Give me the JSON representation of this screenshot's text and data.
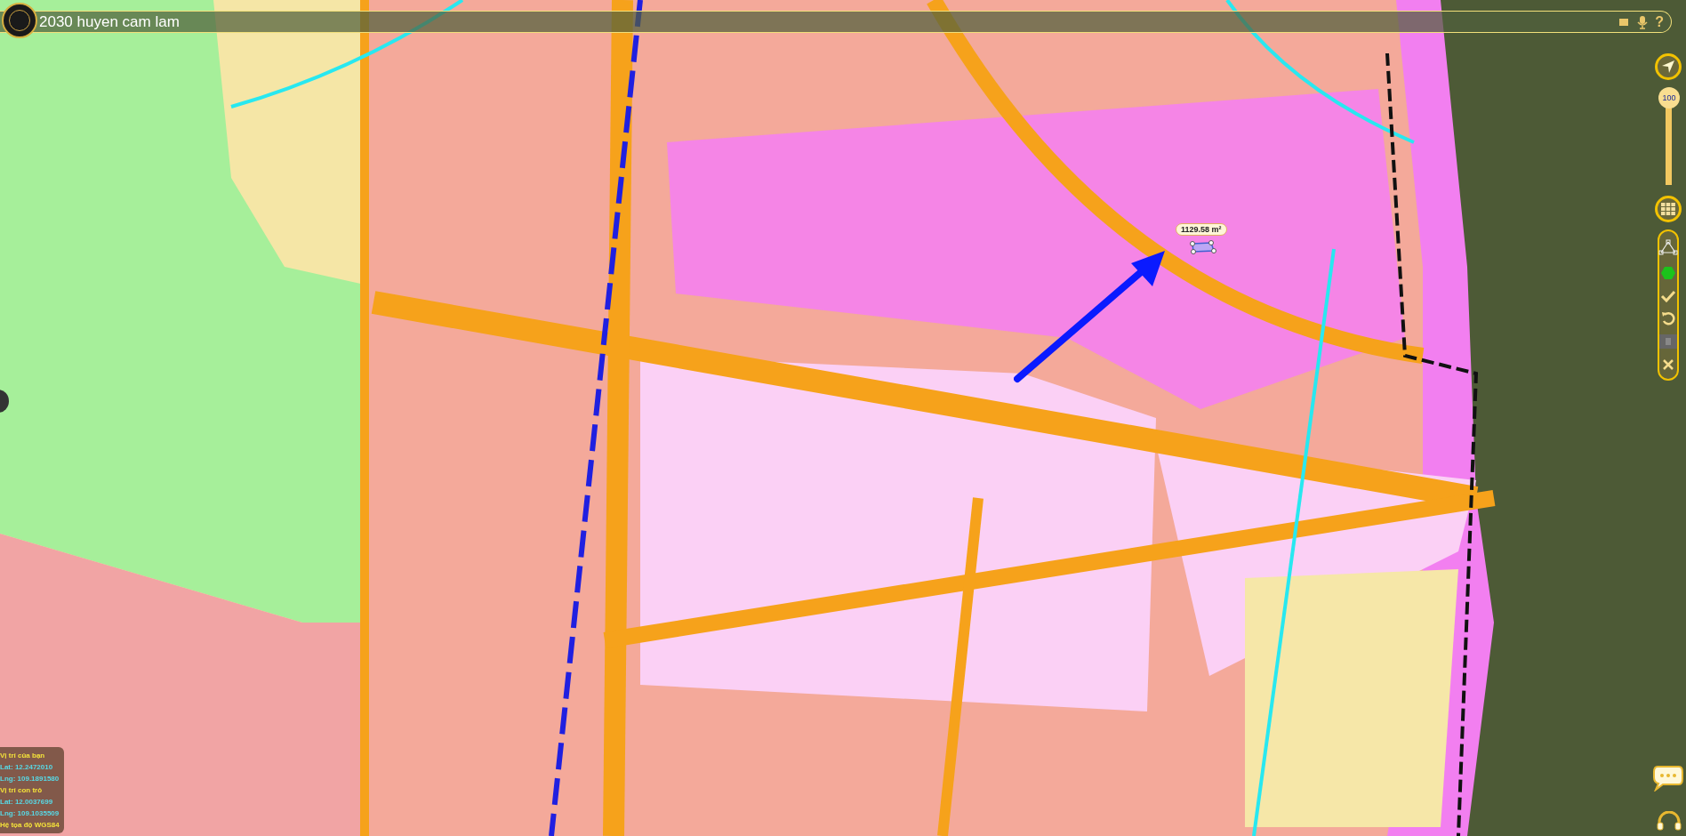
{
  "title_bar": {
    "title": "2030 huyen cam lam",
    "help": "?"
  },
  "zoom_slider": {
    "value": "100",
    "level": 1
  },
  "measurement": {
    "area": "1129.58 m²"
  },
  "info_panel": {
    "lines": [
      {
        "kind": "heading",
        "text": "Vị trí của bạn"
      },
      {
        "kind": "coord",
        "text": "Lat: 12.2472010"
      },
      {
        "kind": "coord",
        "text": "Lng: 109.1891580"
      },
      {
        "kind": "heading",
        "text": "Vị trí con trỏ"
      },
      {
        "kind": "coord",
        "text": "Lat: 12.0037699"
      },
      {
        "kind": "coord",
        "text": "Lng: 109.1035509"
      },
      {
        "kind": "heading",
        "text": "Hệ tọa độ WGS84"
      }
    ]
  }
}
